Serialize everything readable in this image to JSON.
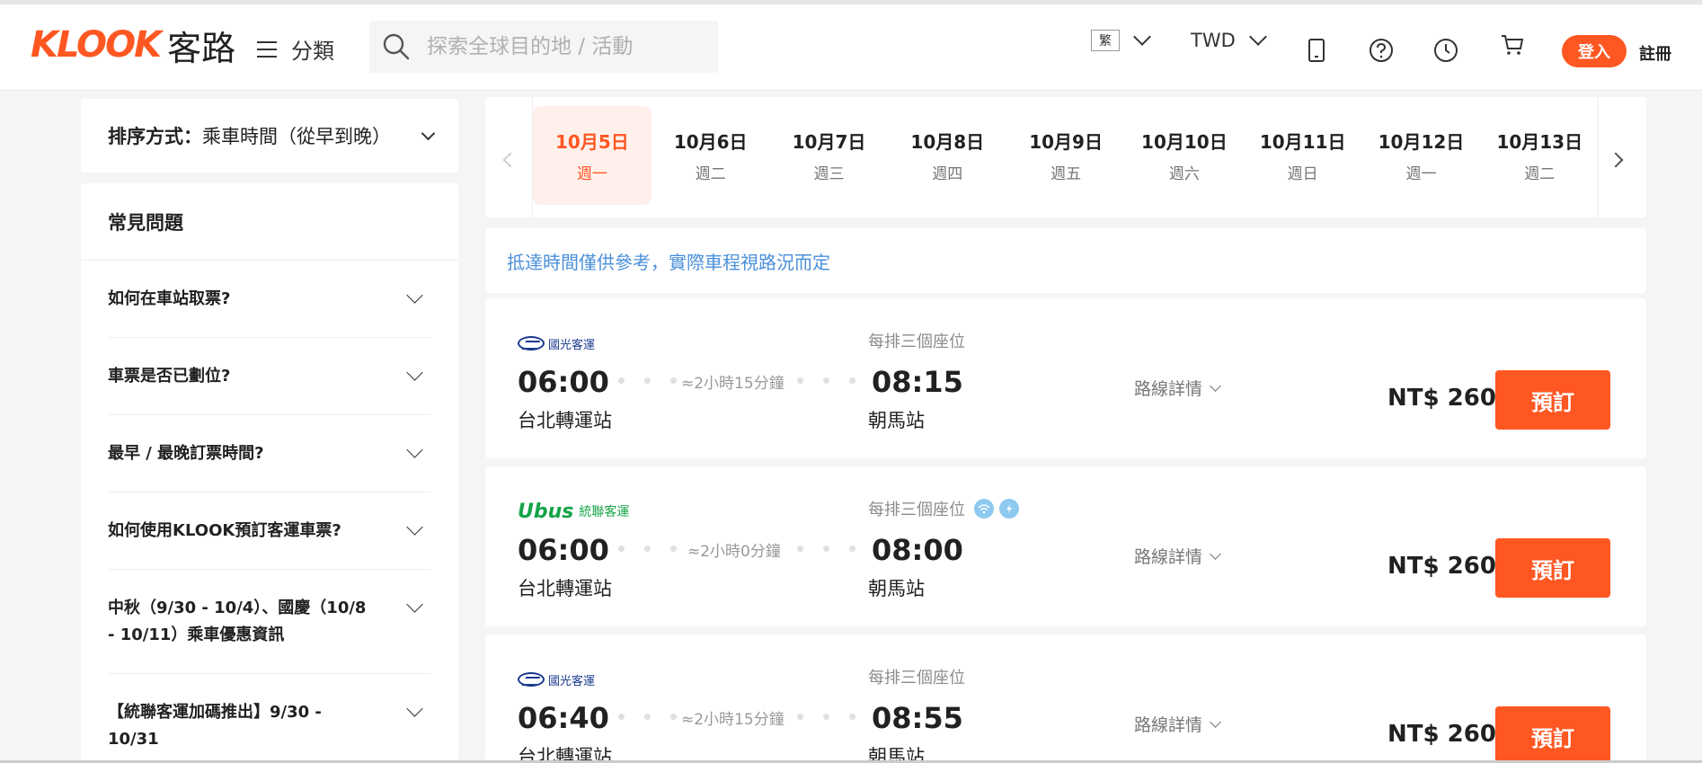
{
  "header": {
    "logo_en": "KLOOK",
    "logo_zh": "客路",
    "category_label": "分類",
    "search_placeholder": "探索全球目的地 / 活動",
    "lang_label": "繁",
    "currency_label": "TWD",
    "login_label": "登入",
    "register_label": "註冊"
  },
  "sidebar": {
    "sort_prefix": "排序方式：",
    "sort_value": "乘車時間（從早到晚）",
    "faq_title": "常見問題",
    "faq_items": [
      "如何在車站取票?",
      "車票是否已劃位?",
      "最早 / 最晚訂票時間?",
      "如何使用KLOOK預訂客運車票?",
      "中秋（9/30 - 10/4）、國慶（10/8 - 10/11）乘車優惠資訊",
      "【統聯客運加碼推出】9/30 - 10/31"
    ]
  },
  "dates": [
    {
      "date": "10月5日",
      "weekday": "週一"
    },
    {
      "date": "10月6日",
      "weekday": "週二"
    },
    {
      "date": "10月7日",
      "weekday": "週三"
    },
    {
      "date": "10月8日",
      "weekday": "週四"
    },
    {
      "date": "10月9日",
      "weekday": "週五"
    },
    {
      "date": "10月10日",
      "weekday": "週六"
    },
    {
      "date": "10月11日",
      "weekday": "週日"
    },
    {
      "date": "10月12日",
      "weekday": "週一"
    },
    {
      "date": "10月13日",
      "weekday": "週二"
    }
  ],
  "notice": "抵達時間僅供參考，實際車程視路況而定",
  "trips": [
    {
      "operator": "國光客運",
      "dep_time": "06:00",
      "dep_station": "台北轉運站",
      "duration": "≈2小時15分鐘",
      "seat_info": "每排三個座位",
      "arr_time": "08:15",
      "arr_station": "朝馬站",
      "route_label": "路線詳情",
      "price": "NT$ 260",
      "book_label": "預訂"
    },
    {
      "operator_en": "Ubus",
      "operator": "統聯客運",
      "dep_time": "06:00",
      "dep_station": "台北轉運站",
      "duration": "≈2小時0分鐘",
      "seat_info": "每排三個座位",
      "arr_time": "08:00",
      "arr_station": "朝馬站",
      "route_label": "路線詳情",
      "price": "NT$ 260",
      "book_label": "預訂"
    },
    {
      "operator": "國光客運",
      "dep_time": "06:40",
      "dep_station": "台北轉運站",
      "duration": "≈2小時15分鐘",
      "seat_info": "每排三個座位",
      "arr_time": "08:55",
      "arr_station": "朝馬站",
      "route_label": "路線詳情",
      "price": "NT$ 260",
      "book_label": "預訂"
    }
  ],
  "colors": {
    "accent": "#ff5722",
    "notice": "#4a90d9",
    "active_date_bg": "#fff0eb"
  }
}
